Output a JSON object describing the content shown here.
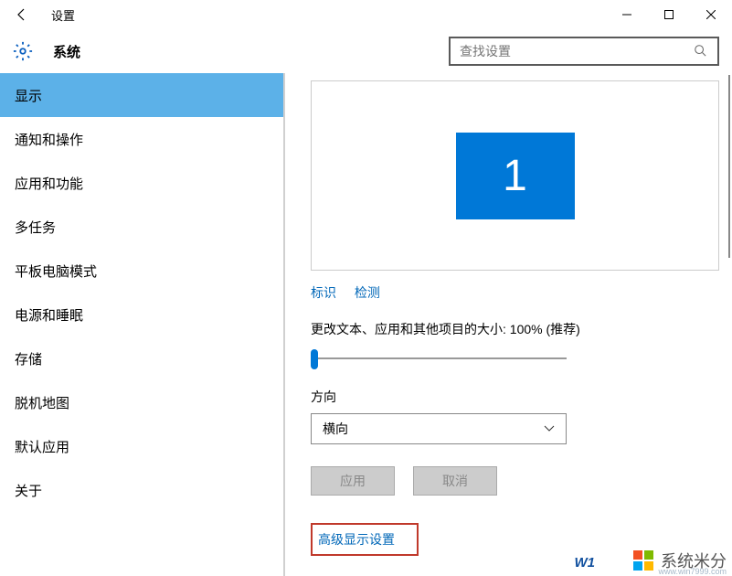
{
  "window": {
    "title": "设置",
    "min": "—",
    "max": "☐",
    "close": "✕",
    "back": "←"
  },
  "header": {
    "title": "系统",
    "search_placeholder": "查找设置"
  },
  "sidebar": {
    "items": [
      {
        "label": "显示",
        "active": true
      },
      {
        "label": "通知和操作",
        "active": false
      },
      {
        "label": "应用和功能",
        "active": false
      },
      {
        "label": "多任务",
        "active": false
      },
      {
        "label": "平板电脑模式",
        "active": false
      },
      {
        "label": "电源和睡眠",
        "active": false
      },
      {
        "label": "存储",
        "active": false
      },
      {
        "label": "脱机地图",
        "active": false
      },
      {
        "label": "默认应用",
        "active": false
      },
      {
        "label": "关于",
        "active": false
      }
    ]
  },
  "display": {
    "monitor_number": "1",
    "identify": "标识",
    "detect": "检测",
    "scale_label": "更改文本、应用和其他项目的大小: 100% (推荐)",
    "orientation_label": "方向",
    "orientation_value": "横向",
    "apply": "应用",
    "cancel": "取消",
    "advanced": "高级显示设置"
  },
  "watermark": {
    "brand": "系统米分",
    "url": "www.win7999.com",
    "wt": "W1"
  }
}
